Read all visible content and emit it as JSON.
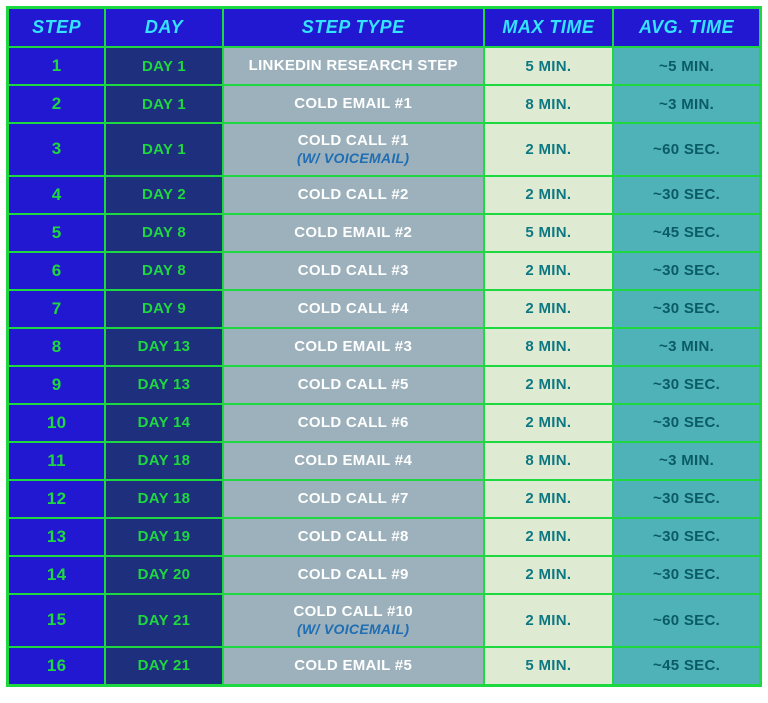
{
  "chart_data": {
    "type": "table",
    "title": "",
    "columns": [
      "STEP",
      "DAY",
      "STEP TYPE",
      "MAX TIME",
      "AVG. TIME"
    ],
    "rows": [
      {
        "step": "1",
        "day": "DAY 1",
        "type": "LINKEDIN RESEARCH STEP",
        "type_sub": "",
        "max": "5 MIN.",
        "avg": "~5 MIN."
      },
      {
        "step": "2",
        "day": "DAY 1",
        "type": "COLD EMAIL #1",
        "type_sub": "",
        "max": "8 MIN.",
        "avg": "~3 MIN."
      },
      {
        "step": "3",
        "day": "DAY 1",
        "type": "COLD CALL #1",
        "type_sub": "(W/ VOICEMAIL)",
        "max": "2 MIN.",
        "avg": "~60 SEC."
      },
      {
        "step": "4",
        "day": "DAY 2",
        "type": "COLD CALL #2",
        "type_sub": "",
        "max": "2 MIN.",
        "avg": "~30 SEC."
      },
      {
        "step": "5",
        "day": "DAY 8",
        "type": "COLD EMAIL #2",
        "type_sub": "",
        "max": "5 MIN.",
        "avg": "~45 SEC."
      },
      {
        "step": "6",
        "day": "DAY 8",
        "type": "COLD CALL #3",
        "type_sub": "",
        "max": "2 MIN.",
        "avg": "~30 SEC."
      },
      {
        "step": "7",
        "day": "DAY 9",
        "type": "COLD CALL #4",
        "type_sub": "",
        "max": "2 MIN.",
        "avg": "~30 SEC."
      },
      {
        "step": "8",
        "day": "DAY 13",
        "type": "COLD EMAIL #3",
        "type_sub": "",
        "max": "8 MIN.",
        "avg": "~3 MIN."
      },
      {
        "step": "9",
        "day": "DAY 13",
        "type": "COLD CALL #5",
        "type_sub": "",
        "max": "2 MIN.",
        "avg": "~30 SEC."
      },
      {
        "step": "10",
        "day": "DAY 14",
        "type": "COLD CALL #6",
        "type_sub": "",
        "max": "2 MIN.",
        "avg": "~30 SEC."
      },
      {
        "step": "11",
        "day": "DAY 18",
        "type": "COLD EMAIL #4",
        "type_sub": "",
        "max": "8 MIN.",
        "avg": "~3 MIN."
      },
      {
        "step": "12",
        "day": "DAY 18",
        "type": "COLD CALL #7",
        "type_sub": "",
        "max": "2 MIN.",
        "avg": "~30 SEC."
      },
      {
        "step": "13",
        "day": "DAY 19",
        "type": "COLD CALL #8",
        "type_sub": "",
        "max": "2 MIN.",
        "avg": "~30 SEC."
      },
      {
        "step": "14",
        "day": "DAY 20",
        "type": "COLD CALL #9",
        "type_sub": "",
        "max": "2 MIN.",
        "avg": "~30 SEC."
      },
      {
        "step": "15",
        "day": "DAY 21",
        "type": "COLD CALL #10",
        "type_sub": "(W/ VOICEMAIL)",
        "max": "2 MIN.",
        "avg": "~60 SEC."
      },
      {
        "step": "16",
        "day": "DAY 21",
        "type": "COLD EMAIL #5",
        "type_sub": "",
        "max": "5 MIN.",
        "avg": "~45 SEC."
      }
    ]
  }
}
